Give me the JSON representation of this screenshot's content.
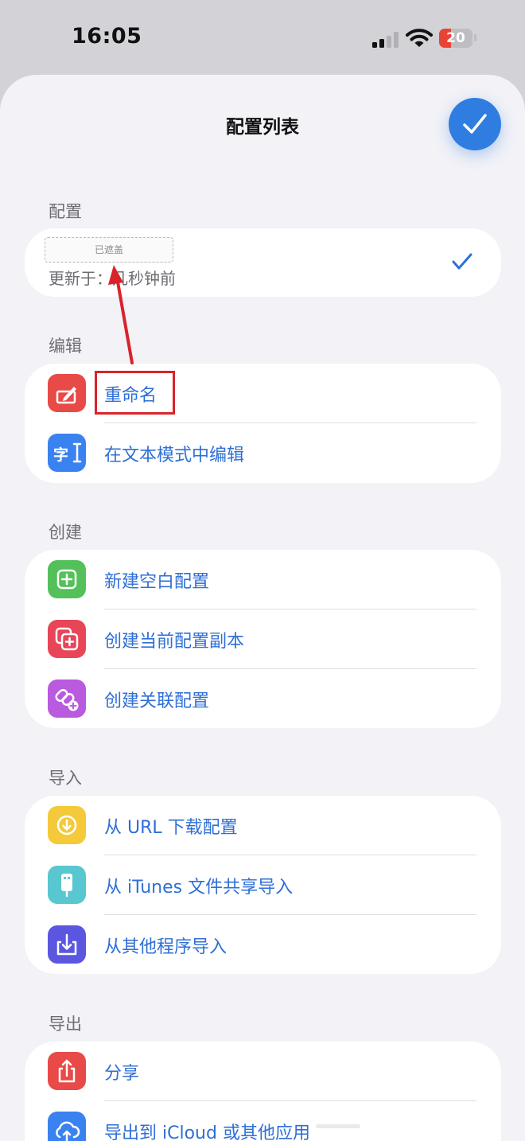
{
  "status_bar": {
    "time": "16:05",
    "battery": "20"
  },
  "sheet": {
    "title": "配置列表"
  },
  "config_section": {
    "header": "配置",
    "masked_label": "已遮盖",
    "subtitle": "更新于：几秒钟前"
  },
  "edit_section": {
    "header": "编辑",
    "items": [
      {
        "label": "重命名",
        "icon": "rename-icon",
        "color": "#e84a48"
      },
      {
        "label": "在文本模式中编辑",
        "icon": "text-edit-icon",
        "color": "#3a82f0"
      }
    ]
  },
  "create_section": {
    "header": "创建",
    "items": [
      {
        "label": "新建空白配置",
        "icon": "plus-square-icon",
        "color": "#53c05a"
      },
      {
        "label": "创建当前配置副本",
        "icon": "duplicate-icon",
        "color": "#e84558"
      },
      {
        "label": "创建关联配置",
        "icon": "link-plus-icon",
        "color": "#b95adf"
      }
    ]
  },
  "import_section": {
    "header": "导入",
    "items": [
      {
        "label": "从 URL 下载配置",
        "icon": "download-circle-icon",
        "color": "#f4c93a"
      },
      {
        "label": "从 iTunes 文件共享导入",
        "icon": "usb-drive-icon",
        "color": "#58c7cf"
      },
      {
        "label": "从其他程序导入",
        "icon": "import-tray-icon",
        "color": "#5b56e0"
      }
    ]
  },
  "export_section": {
    "header": "导出",
    "items": [
      {
        "label": "分享",
        "icon": "share-icon",
        "color": "#e84a48"
      },
      {
        "label": "导出到 iCloud 或其他应用",
        "icon": "cloud-upload-icon",
        "color": "#3a82f0"
      }
    ]
  },
  "colors": {
    "accent": "#2f7de1",
    "annotation": "#d9232b"
  }
}
